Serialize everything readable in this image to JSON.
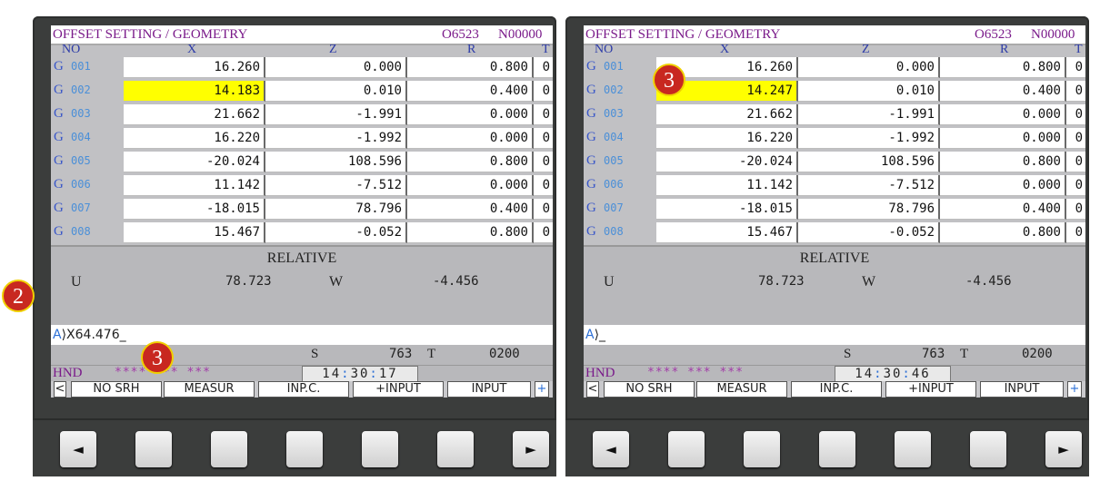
{
  "panels": [
    {
      "title": "OFFSET SETTING / GEOMETRY",
      "program": "O6523",
      "seq": "N00000",
      "headers": {
        "no": "NO",
        "x": "X",
        "z": "Z",
        "r": "R",
        "t": "T"
      },
      "rows": [
        {
          "g": "G",
          "no": "001",
          "x": "16.260",
          "z": "0.000",
          "r": "0.800",
          "t": "0"
        },
        {
          "g": "G",
          "no": "002",
          "x": "14.183",
          "z": "0.010",
          "r": "0.400",
          "t": "0"
        },
        {
          "g": "G",
          "no": "003",
          "x": "21.662",
          "z": "-1.991",
          "r": "0.000",
          "t": "0"
        },
        {
          "g": "G",
          "no": "004",
          "x": "16.220",
          "z": "-1.992",
          "r": "0.000",
          "t": "0"
        },
        {
          "g": "G",
          "no": "005",
          "x": "-20.024",
          "z": "108.596",
          "r": "0.800",
          "t": "0"
        },
        {
          "g": "G",
          "no": "006",
          "x": "11.142",
          "z": "-7.512",
          "r": "0.000",
          "t": "0"
        },
        {
          "g": "G",
          "no": "007",
          "x": "-18.015",
          "z": "78.796",
          "r": "0.400",
          "t": "0"
        },
        {
          "g": "G",
          "no": "008",
          "x": "15.467",
          "z": "-0.052",
          "r": "0.800",
          "t": "0"
        }
      ],
      "relative": {
        "title": "RELATIVE",
        "u_label": "U",
        "u_value": "78.723",
        "w_label": "W",
        "w_value": "-4.456"
      },
      "input": {
        "prompt": "A",
        "text": "⟩X64.476_"
      },
      "status": {
        "s_label": "S",
        "s_value": "763",
        "t_label": "T",
        "t_value": "0200"
      },
      "mode": {
        "hnd": "HND",
        "state": "****  ***  ***",
        "clock_h": "14",
        "clock_m": "30",
        "clock_s": "17"
      },
      "softkeys": [
        "<",
        "NO SRH",
        "MEASUR",
        "INP.C.",
        "+INPUT",
        "INPUT",
        "+"
      ]
    },
    {
      "title": "OFFSET SETTING / GEOMETRY",
      "program": "O6523",
      "seq": "N00000",
      "headers": {
        "no": "NO",
        "x": "X",
        "z": "Z",
        "r": "R",
        "t": "T"
      },
      "rows": [
        {
          "g": "G",
          "no": "001",
          "x": "16.260",
          "z": "0.000",
          "r": "0.800",
          "t": "0"
        },
        {
          "g": "G",
          "no": "002",
          "x": "14.247",
          "z": "0.010",
          "r": "0.400",
          "t": "0"
        },
        {
          "g": "G",
          "no": "003",
          "x": "21.662",
          "z": "-1.991",
          "r": "0.000",
          "t": "0"
        },
        {
          "g": "G",
          "no": "004",
          "x": "16.220",
          "z": "-1.992",
          "r": "0.000",
          "t": "0"
        },
        {
          "g": "G",
          "no": "005",
          "x": "-20.024",
          "z": "108.596",
          "r": "0.800",
          "t": "0"
        },
        {
          "g": "G",
          "no": "006",
          "x": "11.142",
          "z": "-7.512",
          "r": "0.000",
          "t": "0"
        },
        {
          "g": "G",
          "no": "007",
          "x": "-18.015",
          "z": "78.796",
          "r": "0.400",
          "t": "0"
        },
        {
          "g": "G",
          "no": "008",
          "x": "15.467",
          "z": "-0.052",
          "r": "0.800",
          "t": "0"
        }
      ],
      "relative": {
        "title": "RELATIVE",
        "u_label": "U",
        "u_value": "78.723",
        "w_label": "W",
        "w_value": "-4.456"
      },
      "input": {
        "prompt": "A",
        "text": "⟩_"
      },
      "status": {
        "s_label": "S",
        "s_value": "763",
        "t_label": "T",
        "t_value": "0200"
      },
      "mode": {
        "hnd": "HND",
        "state": "****  ***  ***",
        "clock_h": "14",
        "clock_m": "30",
        "clock_s": "46"
      },
      "softkeys": [
        "<",
        "NO SRH",
        "MEASUR",
        "INP.C.",
        "+INPUT",
        "INPUT",
        "+"
      ]
    }
  ],
  "hardware_keys": [
    "◄",
    "",
    "",
    "",
    "",
    "",
    "►"
  ],
  "annotations": {
    "left_step": "2",
    "left_softkey_step": "3",
    "right_cell_step": "3"
  },
  "colors": {
    "highlight": "#ffff00",
    "badge": "#c82820",
    "badge_border": "#f0d000",
    "title_text": "#7a1a8a",
    "header_text": "#2b3aa8"
  }
}
